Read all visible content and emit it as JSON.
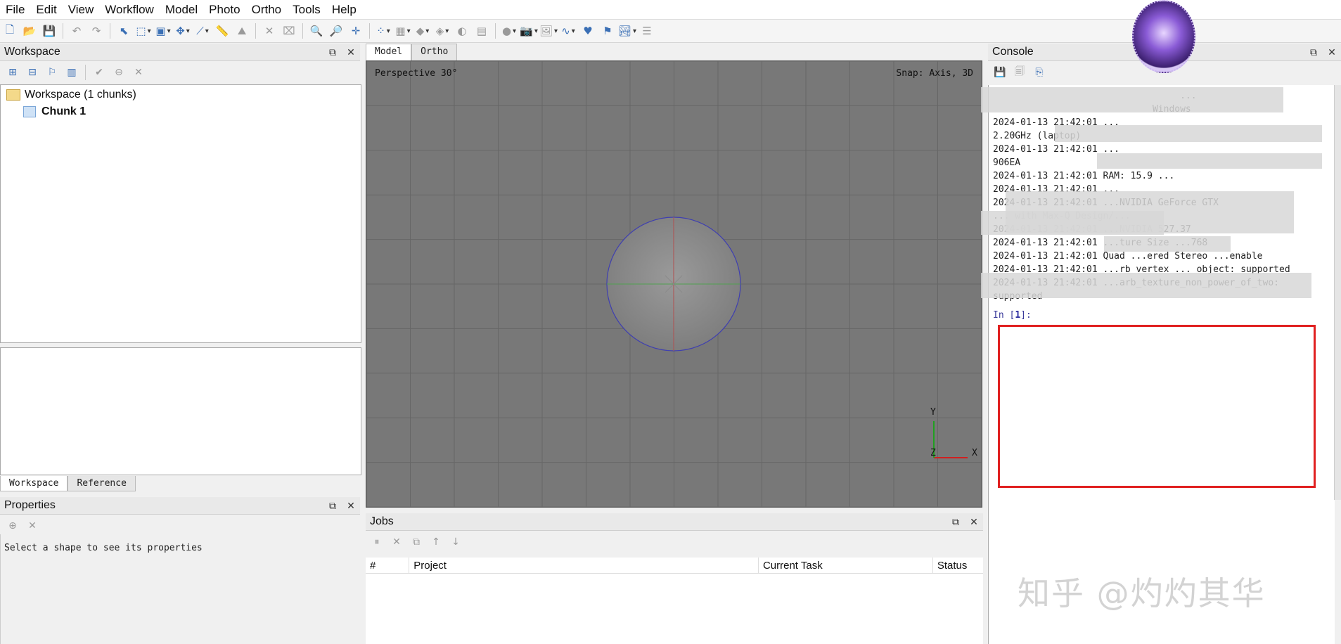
{
  "menu": [
    "File",
    "Edit",
    "View",
    "Workflow",
    "Model",
    "Photo",
    "Ortho",
    "Tools",
    "Help"
  ],
  "workspace": {
    "title": "Workspace",
    "root_label": "Workspace (1 chunks)",
    "chunk_label": "Chunk 1",
    "tabs": [
      "Workspace",
      "Reference"
    ]
  },
  "properties": {
    "title": "Properties",
    "message": "Select a shape to see its properties"
  },
  "view_tabs": [
    "Model",
    "Ortho"
  ],
  "viewport": {
    "perspective": "Perspective 30°",
    "snap": "Snap: Axis, 3D",
    "axis_y": "Y",
    "axis_z": "Z",
    "axis_x": "X",
    "colors": {
      "background": "#787878",
      "grid": "#666666",
      "sphere_outline": "#3f3fb0",
      "axis_x": "#d02020",
      "axis_y": "#20a020"
    }
  },
  "jobs": {
    "title": "Jobs",
    "columns": [
      "#",
      "Project",
      "Current Task",
      "Status"
    ]
  },
  "console": {
    "title": "Console",
    "lines": [
      "                                  ...",
      "                             Windows",
      "2024-01-13 21:42:01 ...",
      "2.20GHz (laptop)",
      "2024-01-13 21:42:01 ...",
      "906EA",
      "2024-01-13 21:42:01 RAM: 15.9 ...",
      "2024-01-13 21:42:01 ...",
      "2024-01-13 21:42:01 ...NVIDIA GeForce GTX",
      "... with Max-Q Design/...",
      "2024-01-13 21:42:01 ...NVIDIA 527.37",
      "2024-01-13 21:42:01 ...ture Size ...768",
      "2024-01-13 21:42:01 Quad ...ered Stereo ...enable",
      "2024-01-13 21:42:01 ...rb vertex ... object: supported",
      "2024-01-13 21:42:01 ...arb_texture_non_power_of_two:",
      "supported"
    ],
    "prompt_prefix": "In [",
    "prompt_num": "1",
    "prompt_suffix": "]:"
  },
  "watermark": "知乎 @灼灼其华",
  "accent": "#3a6fb5",
  "highlight_box_color": "#e02020"
}
